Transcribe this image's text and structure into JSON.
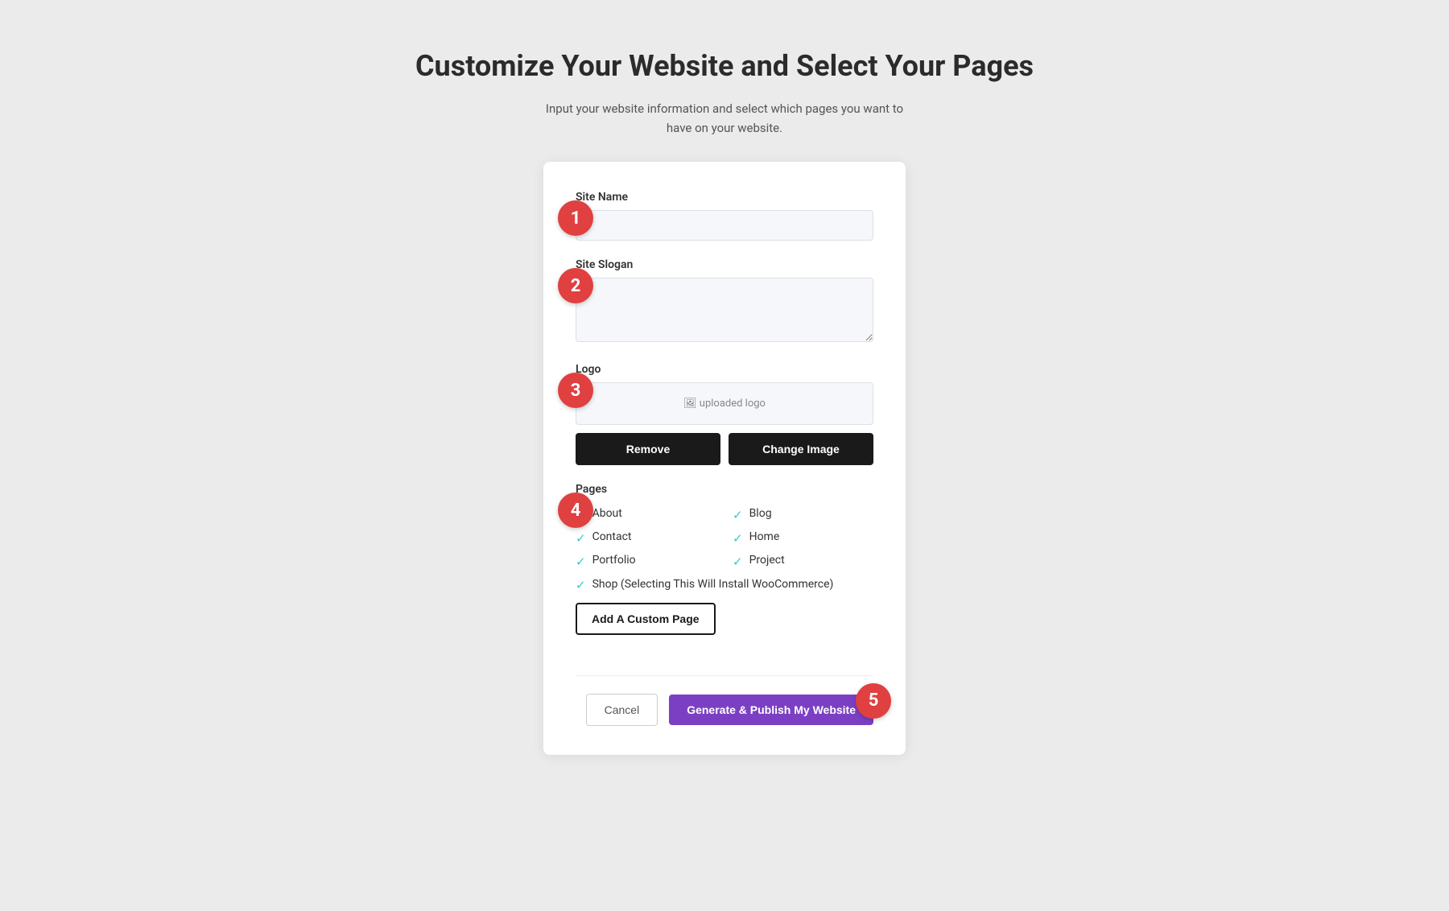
{
  "header": {
    "title": "Customize Your Website and Select Your Pages",
    "subtitle": "Input your website information and select which pages you want to have on your website."
  },
  "form": {
    "site_name_label": "Site Name",
    "site_name_placeholder": "",
    "site_slogan_label": "Site Slogan",
    "site_slogan_placeholder": "",
    "logo_label": "Logo",
    "logo_placeholder": "uploaded logo",
    "remove_button": "Remove",
    "change_image_button": "Change Image",
    "pages_label": "Pages",
    "pages": [
      {
        "label": "About",
        "checked": true,
        "col": 1
      },
      {
        "label": "Blog",
        "checked": true,
        "col": 2
      },
      {
        "label": "Contact",
        "checked": true,
        "col": 1
      },
      {
        "label": "Home",
        "checked": true,
        "col": 2
      },
      {
        "label": "Portfolio",
        "checked": true,
        "col": 1
      },
      {
        "label": "Project",
        "checked": true,
        "col": 2
      }
    ],
    "shop_label": "Shop (Selecting This Will Install WooCommerce)",
    "shop_checked": true,
    "add_custom_page_button": "Add A Custom Page",
    "cancel_button": "Cancel",
    "publish_button": "Generate & Publish My Website"
  },
  "steps": {
    "step1": "1",
    "step2": "2",
    "step3": "3",
    "step4": "4",
    "step5": "5"
  },
  "colors": {
    "step_badge": "#e04040",
    "check": "#3cc",
    "publish_btn": "#7b3fc4"
  }
}
